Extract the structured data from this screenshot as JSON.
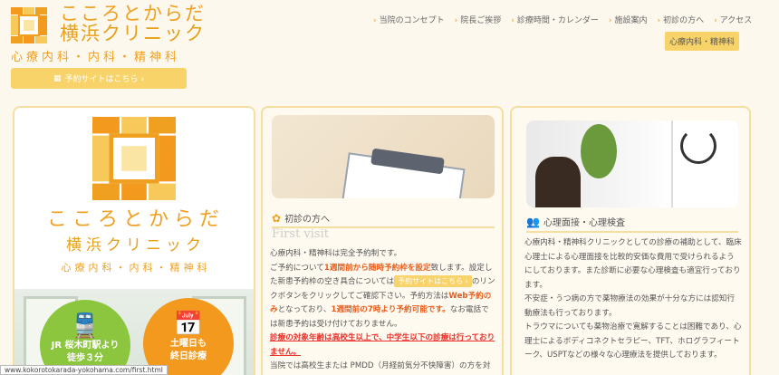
{
  "header": {
    "title_line1": "こころとからだ",
    "title_line2": "横浜クリニック",
    "subtitle": "心療内科・内科・精神科",
    "reserve_label": "予約サイトはこちら ›",
    "nav": [
      "当院のコンセプト",
      "院長ご挨拶",
      "診療時間・カレンダー",
      "施設案内",
      "初診の方へ",
      "アクセス"
    ],
    "dept_badge": "心療内科・精神科"
  },
  "hero": {
    "title_line1": "こころとからだ",
    "title_line2": "横浜クリニック",
    "subtitle": "心療内科・内科・精神科",
    "badge_station_line1": "JR 桜木町駅より",
    "badge_station_line2": "徒歩３分",
    "badge_sat_line1": "土曜日も",
    "badge_sat_line2": "終日診療"
  },
  "first_visit": {
    "heading": "初診の方へ",
    "heading_en": "First visit",
    "p1": "心療内科・精神科は完全予約制です。",
    "p2a": "ご予約について",
    "p2b": "1週間前から随時予約枠を設定",
    "p2c": "致します。設定した新患予約枠の空き具合については",
    "p2_btn": "予約サイトはこちら ›",
    "p2d": "のリンクボタンをクリックしてご確認下さい。予約方法は",
    "p2e": "Web予約のみ",
    "p2f": "となっており、",
    "p2g": "1週間前の7時より予約可能です。",
    "p2h": "なお電話では新患予約は受け付けておりません。",
    "p3": "診療の対象年齢は高校生以上で、中学生以下の診療は行っておりません。",
    "p4": "当院では高校生または PMDD（月経前気分不快障害）の方を対象にして予約を優先しております。高校生方も"
  },
  "psych": {
    "heading": "心理面接・心理検査",
    "p1": "心療内科・精神科クリニックとしての診療の補助として、臨床心理士による心理面接を比較的安価な費用で受けられるようにしております。また診断に必要な心理検査も適宜行っております。",
    "p2": "不安症・うつ病の方で薬物療法の効果が十分な方には認知行動療法も行っております。",
    "p3": "トラウマについても薬物治療で寛解することは困難であり、心理士によるボディコネクトセラピー、TFT、ホログラフィートーク、USPTなどの様々な心理療法を提供しております。"
  },
  "status_url": "www.kokorotokarada-yokohama.com/first.html",
  "colors": {
    "accent": "#f0a020",
    "button": "#f7d36a",
    "green": "#8cc63f",
    "orange": "#f39a1e",
    "red": "#e8322a"
  }
}
